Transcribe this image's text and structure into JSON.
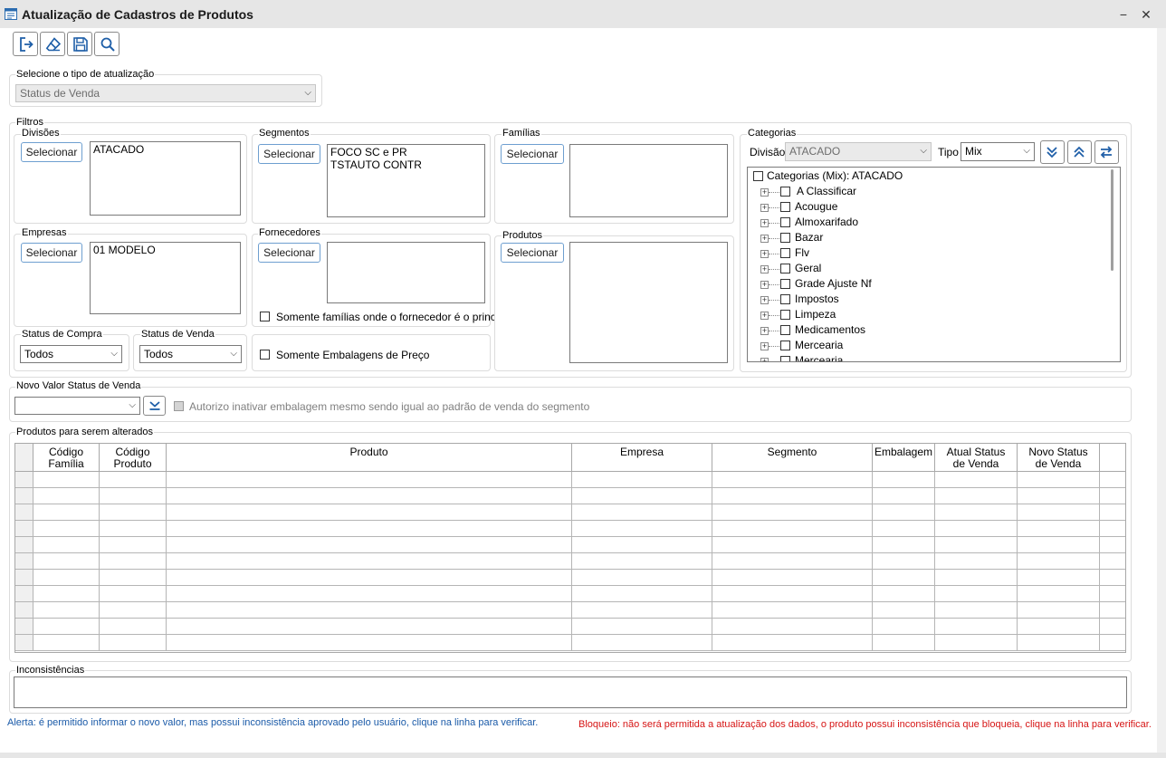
{
  "window": {
    "title": "Atualização de Cadastros de Produtos",
    "minimize": "−",
    "close": "✕"
  },
  "toolbar": {
    "items": [
      "exit-icon",
      "eraser-icon",
      "save-icon",
      "search-icon"
    ]
  },
  "update_type": {
    "label": "Selecione o tipo de atualização",
    "value": "Status de Venda"
  },
  "filters": {
    "label": "Filtros",
    "divisions": {
      "label": "Divisões",
      "button": "Selecionar",
      "items": [
        "ATACADO"
      ]
    },
    "segments": {
      "label": "Segmentos",
      "button": "Selecionar",
      "items": [
        "FOCO SC e PR",
        "TSTAUTO CONTR"
      ]
    },
    "families": {
      "label": "Famílias",
      "button": "Selecionar",
      "items": []
    },
    "companies": {
      "label": "Empresas",
      "button": "Selecionar",
      "items": [
        "01 MODELO"
      ]
    },
    "suppliers": {
      "label": "Fornecedores",
      "button": "Selecionar",
      "items": [],
      "checkbox": "Somente famílias onde o fornecedor é o principal"
    },
    "products": {
      "label": "Produtos",
      "button": "Selecionar",
      "items": []
    },
    "purchase_status": {
      "label": "Status de Compra",
      "value": "Todos"
    },
    "sale_status": {
      "label": "Status de Venda",
      "value": "Todos"
    },
    "price_pack": {
      "checkbox": "Somente Embalagens de Preço"
    }
  },
  "categories": {
    "label": "Categorias",
    "division_label": "Divisão",
    "division_value": "ATACADO",
    "type_label": "Tipo",
    "type_value": "Mix",
    "root": "Categorias (Mix): ATACADO",
    "items": [
      "A Classificar",
      "Acougue",
      "Almoxarifado",
      "Bazar",
      "Flv",
      "Geral",
      "Grade Ajuste Nf",
      "Impostos",
      "Limpeza",
      "Medicamentos",
      "Mercearia",
      "Mercearia"
    ]
  },
  "new_value": {
    "label": "Novo Valor Status de Venda",
    "value": "",
    "authorize": "Autorizo inativar embalagem mesmo sendo igual ao padrão de venda do segmento"
  },
  "products_grid": {
    "label": "Produtos para serem alterados",
    "columns": [
      [
        "Código",
        "Família"
      ],
      [
        "Código",
        "Produto"
      ],
      [
        "Produto",
        ""
      ],
      [
        "Empresa",
        ""
      ],
      [
        "Segmento",
        ""
      ],
      [
        "Embalagem",
        ""
      ],
      [
        "Atual Status",
        "de Venda"
      ],
      [
        "Novo Status",
        "de Venda"
      ]
    ]
  },
  "inconsistencies": {
    "label": "Inconsistências"
  },
  "footer": {
    "alert": "Alerta: é permitido informar o novo valor, mas possui inconsistência aprovado pelo usuário, clique na linha para verificar.",
    "block": "Bloqueio: não será permitida a atualização dos dados, o produto possui inconsistência que bloqueia, clique na linha para verificar."
  },
  "colors": {
    "alert": "#1a5aa8",
    "block": "#d61515",
    "accent": "#1f6bb8"
  }
}
